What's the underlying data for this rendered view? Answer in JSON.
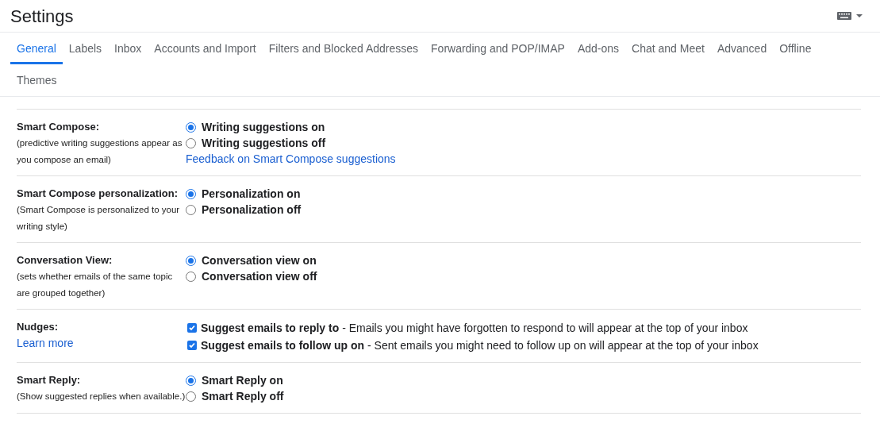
{
  "header": {
    "title": "Settings"
  },
  "tabs": [
    {
      "label": "General",
      "selected": true
    },
    {
      "label": "Labels",
      "selected": false
    },
    {
      "label": "Inbox",
      "selected": false
    },
    {
      "label": "Accounts and Import",
      "selected": false
    },
    {
      "label": "Filters and Blocked Addresses",
      "selected": false
    },
    {
      "label": "Forwarding and POP/IMAP",
      "selected": false
    },
    {
      "label": "Add-ons",
      "selected": false
    },
    {
      "label": "Chat and Meet",
      "selected": false
    },
    {
      "label": "Advanced",
      "selected": false
    },
    {
      "label": "Offline",
      "selected": false
    },
    {
      "label": "Themes",
      "selected": false
    }
  ],
  "settings": [
    {
      "title": "Smart Compose:",
      "description": "(predictive writing suggestions appear as you compose an email)",
      "kind": "radio",
      "options": [
        {
          "label": "Writing suggestions on",
          "selected": true
        },
        {
          "label": "Writing suggestions off",
          "selected": false
        }
      ],
      "link": "Feedback on Smart Compose suggestions"
    },
    {
      "title": "Smart Compose personalization:",
      "description": "(Smart Compose is personalized to your writing style)",
      "kind": "radio",
      "options": [
        {
          "label": "Personalization on",
          "selected": true
        },
        {
          "label": "Personalization off",
          "selected": false
        }
      ]
    },
    {
      "title": "Conversation View:",
      "description": "(sets whether emails of the same topic are grouped together)",
      "kind": "radio",
      "options": [
        {
          "label": "Conversation view on",
          "selected": true
        },
        {
          "label": "Conversation view off",
          "selected": false
        }
      ]
    },
    {
      "title": "Nudges:",
      "title_link": "Learn more",
      "kind": "checkbox",
      "options": [
        {
          "label": "**Suggest emails to reply to** - Emails you might have forgotten to respond to will appear at the top of your inbox",
          "checked": true
        },
        {
          "label": "**Suggest emails to follow up on** - Sent emails you might need to follow up on will appear at the top of your inbox",
          "checked": true
        }
      ]
    },
    {
      "title": "Smart Reply:",
      "description": "(Show suggested replies when available.)",
      "kind": "radio",
      "options": [
        {
          "label": "Smart Reply on",
          "selected": true
        },
        {
          "label": "Smart Reply off",
          "selected": false
        }
      ]
    }
  ]
}
